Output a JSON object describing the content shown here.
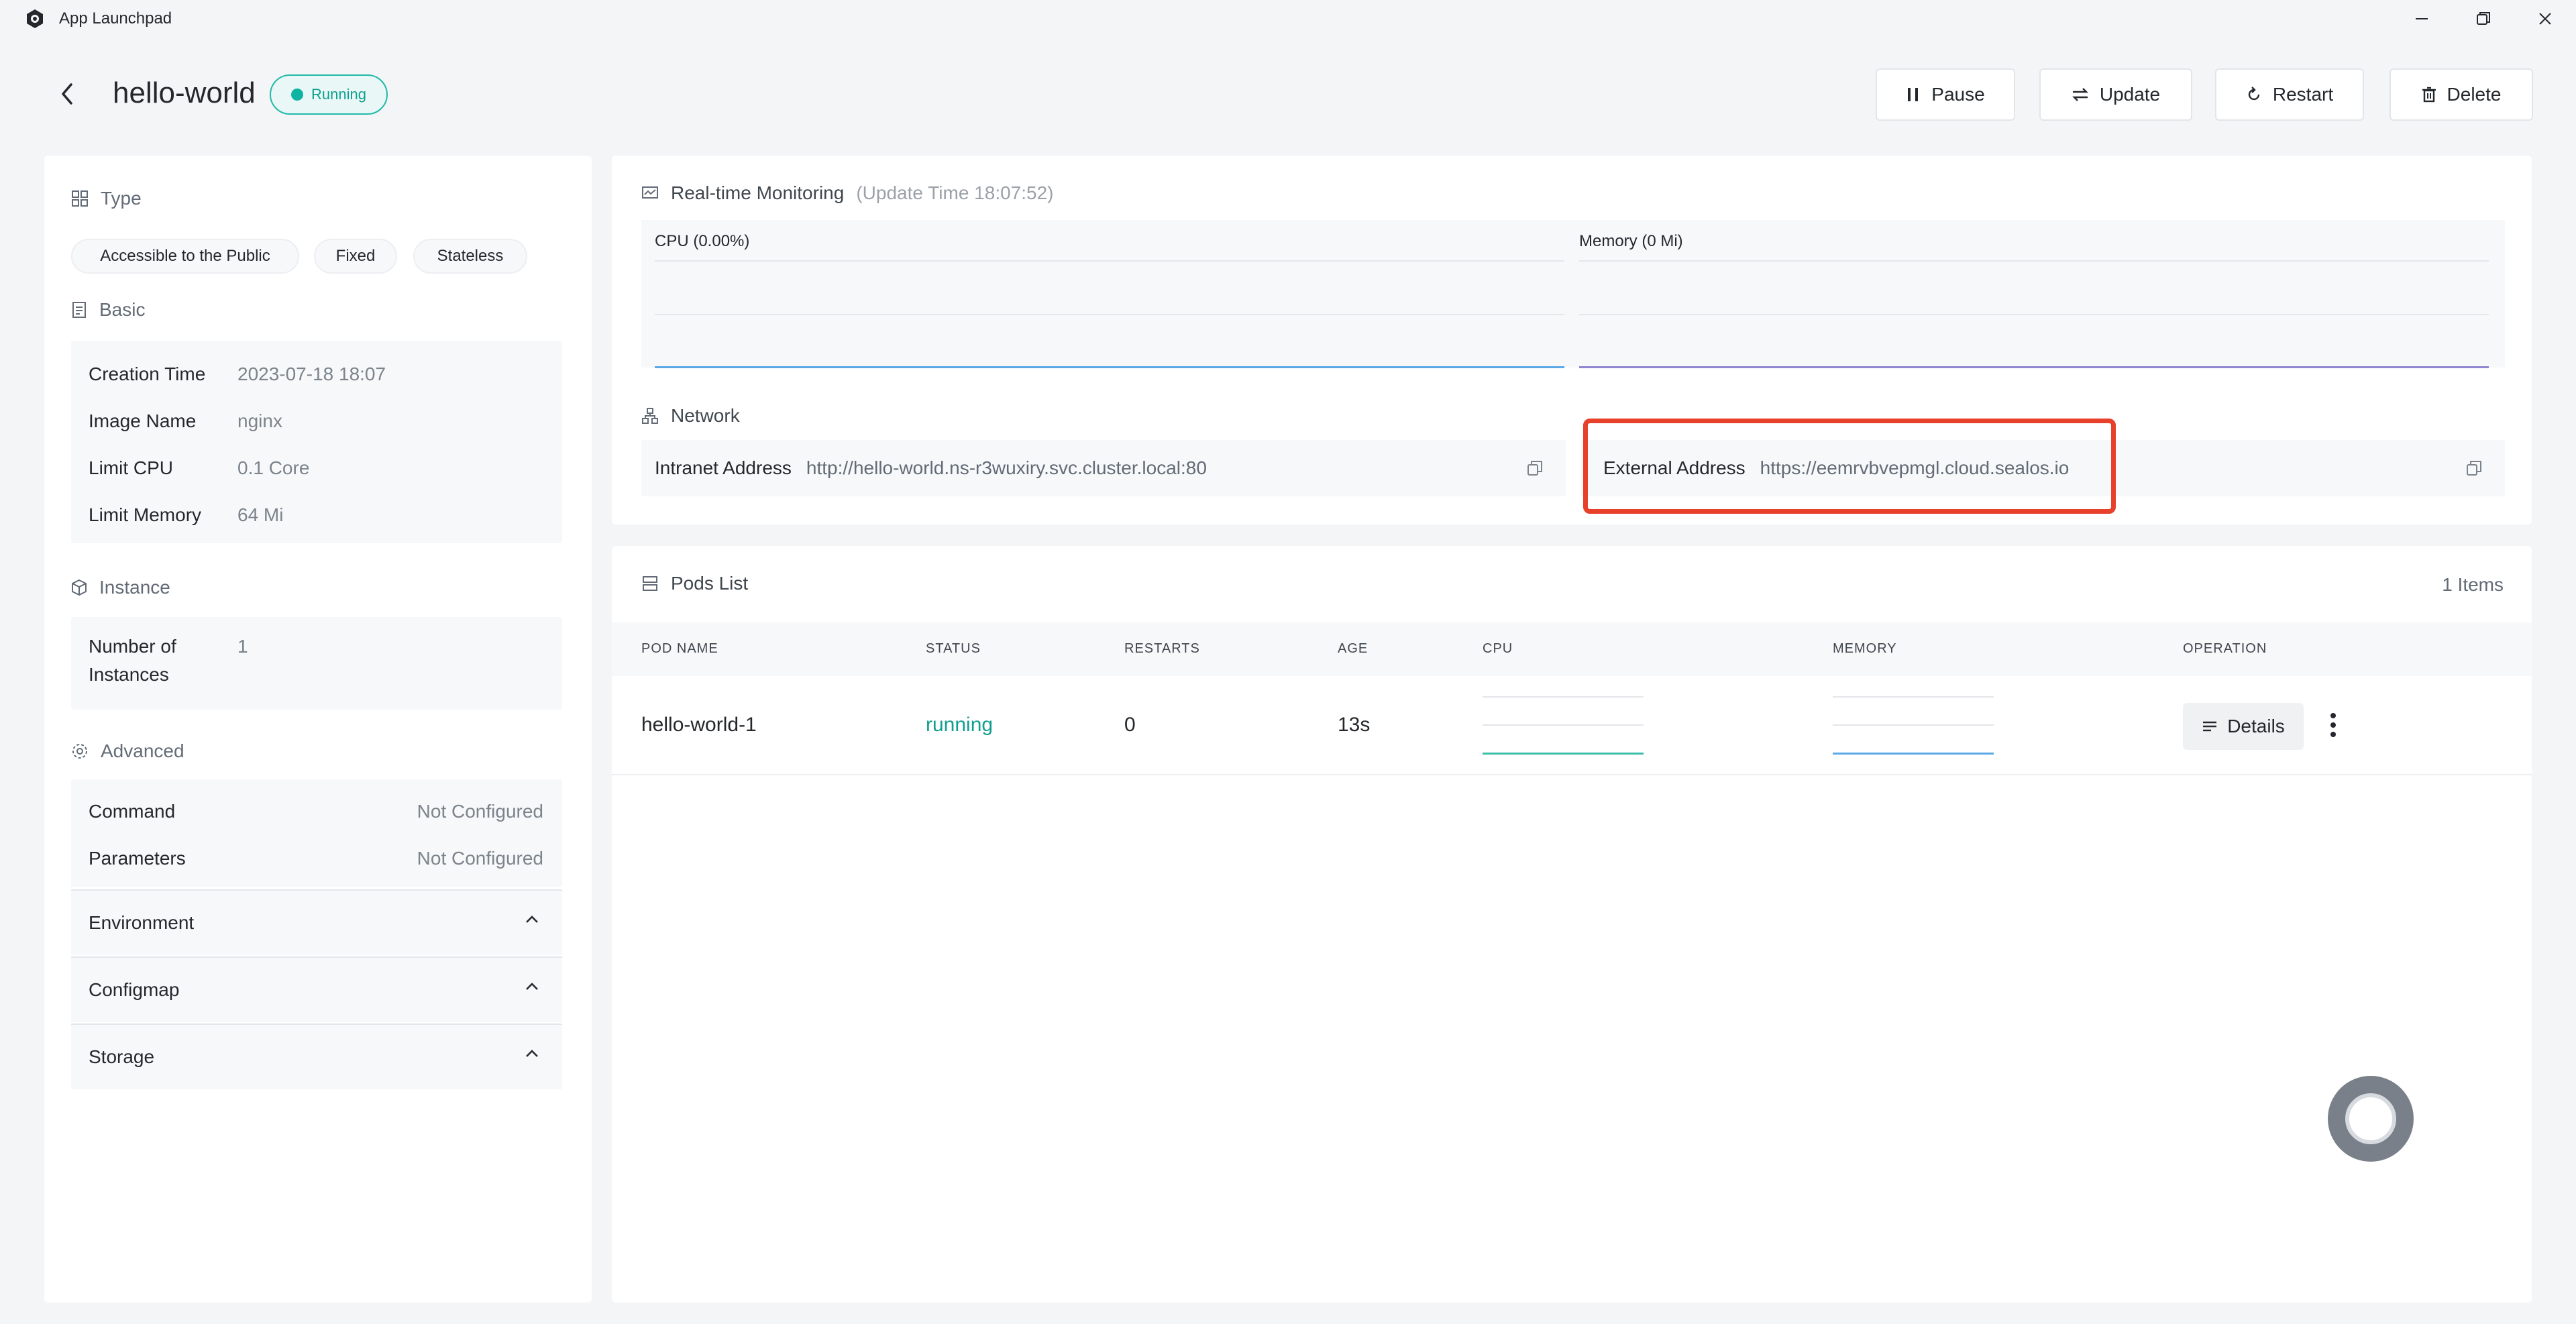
{
  "window": {
    "title": "App Launchpad"
  },
  "header": {
    "app_name": "hello-world",
    "status": "Running",
    "buttons": {
      "pause": "Pause",
      "update": "Update",
      "restart": "Restart",
      "delete": "Delete"
    }
  },
  "left": {
    "type_title": "Type",
    "type_chips": [
      "Accessible to the Public",
      "Fixed",
      "Stateless"
    ],
    "basic_title": "Basic",
    "basic": [
      {
        "label": "Creation Time",
        "value": "2023-07-18 18:07"
      },
      {
        "label": "Image Name",
        "value": "nginx"
      },
      {
        "label": "Limit CPU",
        "value": "0.1 Core"
      },
      {
        "label": "Limit Memory",
        "value": "64 Mi"
      }
    ],
    "instance_title": "Instance",
    "instance_label_line1": "Number of",
    "instance_label_line2": "Instances",
    "instance_value": "1",
    "advanced_title": "Advanced",
    "advanced": [
      {
        "label": "Command",
        "value": "Not Configured"
      },
      {
        "label": "Parameters",
        "value": "Not Configured"
      }
    ],
    "accordions": [
      "Environment",
      "Configmap",
      "Storage"
    ]
  },
  "monitor": {
    "title": "Real-time Monitoring",
    "update_time": "(Update Time  18:07:52)",
    "cpu_label": "CPU  (0.00%)",
    "memory_label": "Memory  (0 Mi)",
    "cpu_color": "#5aa9e6",
    "memory_color": "#8f86cf"
  },
  "network": {
    "title": "Network",
    "intranet_label": "Intranet Address",
    "intranet_value": "http://hello-world.ns-r3wuxiry.svc.cluster.local:80",
    "external_label": "External Address",
    "external_value": "https://eemrvbvepmgl.cloud.sealos.io"
  },
  "pods": {
    "title": "Pods List",
    "count": "1 Items",
    "columns": [
      "POD NAME",
      "STATUS",
      "RESTARTS",
      "AGE",
      "CPU",
      "MEMORY",
      "OPERATION"
    ],
    "rows": [
      {
        "name": "hello-world-1",
        "status": "running",
        "restarts": "0",
        "age": "13s"
      }
    ],
    "details_label": "Details"
  },
  "colors": {
    "accent": "#0fb3a2",
    "highlight": "#e8412b"
  }
}
